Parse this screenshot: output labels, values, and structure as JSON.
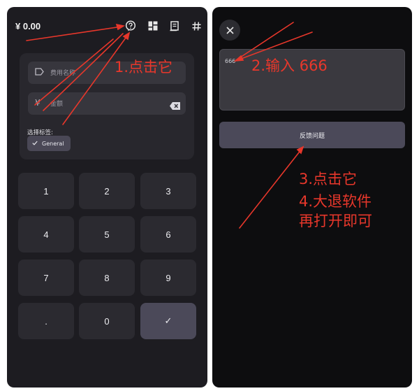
{
  "left": {
    "balance": "¥ 0.00",
    "header_icons": [
      "help-circle-icon",
      "dashboard-icon",
      "receipt-icon",
      "hash-icon"
    ],
    "name_placeholder": "费用名称",
    "amount_symbol": "¥",
    "amount_placeholder": "金额",
    "tag_label": "选择标签:",
    "tag_chip": "General",
    "keys": [
      "1",
      "2",
      "3",
      "4",
      "5",
      "6",
      "7",
      "8",
      "9",
      ".",
      "0",
      "✓"
    ]
  },
  "right": {
    "feedback_value": "666",
    "submit_label": "反馈问题"
  },
  "annotations": {
    "step1": "1.点击它",
    "step2": "2.输入 666",
    "step3": "3.点击它",
    "step4": "4.大退软件",
    "step5": "再打开即可"
  },
  "colors": {
    "annotation": "#e8372b",
    "panel_bg": "#1d1c21",
    "accent": "#4b4959"
  }
}
